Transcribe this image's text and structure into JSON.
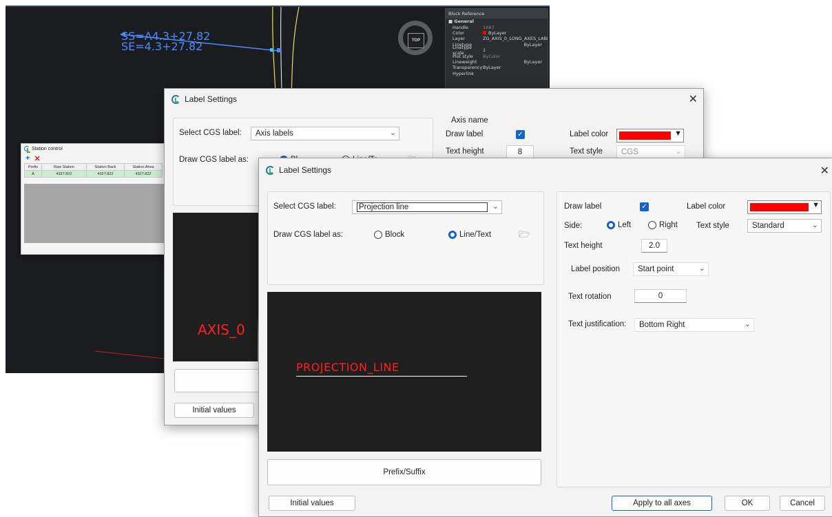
{
  "cad": {
    "station_label_1": "SS=A4.3+27.82",
    "station_label_2": "SE=4.3+27.82",
    "cube_label": "TOP"
  },
  "properties": {
    "header": "Block Reference",
    "section": "General",
    "rows": [
      {
        "k": "Handle",
        "v": "1A87"
      },
      {
        "k": "Color",
        "v": "ByLayer"
      },
      {
        "k": "Layer",
        "v": "ZG_AXIS_0_LONG_AXES_LABEL"
      },
      {
        "k": "Linetype",
        "v": "ByLayer"
      },
      {
        "k": "Linetype scale",
        "v": "1"
      },
      {
        "k": "Plot style",
        "v": "ByColor"
      },
      {
        "k": "Lineweight",
        "v": "ByLayer"
      },
      {
        "k": "Transparency",
        "v": "ByLayer"
      },
      {
        "k": "Hyperlink",
        "v": ""
      }
    ]
  },
  "station_control": {
    "title": "Station control",
    "columns": [
      "Prefix",
      "Raw Station",
      "Station Back",
      "Station Ahea"
    ],
    "row": [
      "A",
      "4327.822",
      "4327.822",
      "4327.822"
    ]
  },
  "dialog_back": {
    "title": "Label Settings",
    "select_label": "Select CGS label:",
    "select_value": "Axis labels",
    "draw_as_label": "Draw CGS label as:",
    "radio_block_partial": "Bl",
    "radio_line_partial": "Line/Te",
    "group_title": "Axis name",
    "draw_label": "Draw label",
    "label_color": "Label color",
    "text_height": "Text height",
    "text_height_value": "8",
    "text_style": "Text style",
    "text_style_value": "CGS",
    "preview_text": "AXIS_0",
    "initial_values": "Initial values"
  },
  "dialog_front": {
    "title": "Label Settings",
    "select_label": "Select CGS label:",
    "select_value": "Projection line",
    "draw_as_label": "Draw CGS label as:",
    "radio_block": "Block",
    "radio_line": "Line/Text",
    "draw_label": "Draw label",
    "label_color": "Label color",
    "side": "Side:",
    "side_left": "Left",
    "side_right": "Right",
    "text_style": "Text style",
    "text_style_value": "Standard",
    "text_height": "Text height",
    "text_height_value": "2.0",
    "label_position": "Label position",
    "label_position_value": "Start point",
    "text_rotation": "Text rotation",
    "text_rotation_value": "0",
    "text_justification": "Text justification:",
    "text_justification_value": "Bottom Right",
    "preview_text": "PROJECTION_LINE",
    "prefix_suffix": "Prefix/Suffix",
    "initial_values": "Initial values",
    "apply_all": "Apply to all axes",
    "ok": "OK",
    "cancel": "Cancel"
  },
  "colors": {
    "accent": "#1463c8",
    "label_red": "#ff0000",
    "cad_blue": "#4a8cff"
  }
}
